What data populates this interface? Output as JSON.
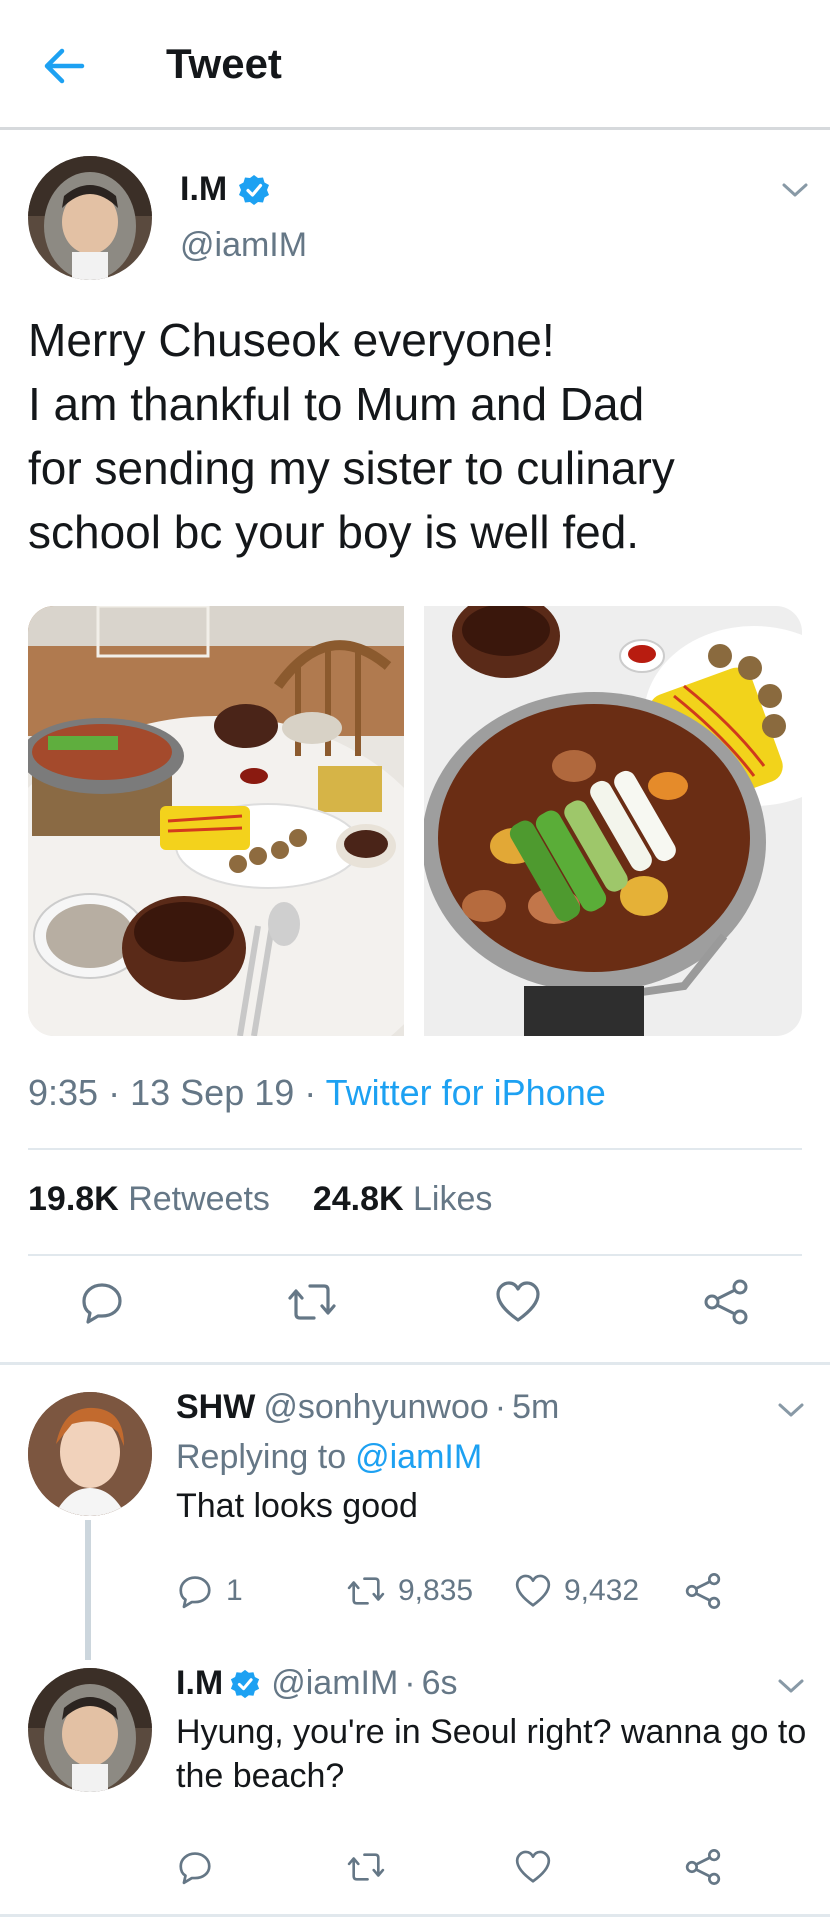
{
  "header": {
    "title": "Tweet"
  },
  "tweet": {
    "display_name": "I.M",
    "handle": "@iamIM",
    "text_lines": [
      "Merry Chuseok everyone!",
      "I am thankful to Mum and Dad",
      "for sending my sister to culinary",
      "school bc your boy is well fed."
    ],
    "time": "9:35",
    "sep": "·",
    "date": "13 Sep 19",
    "source": "Twitter for iPhone",
    "retweets_count": "19.8K",
    "retweets_label": "Retweets",
    "likes_count": "24.8K",
    "likes_label": "Likes"
  },
  "replies": [
    {
      "display_name": "SHW",
      "handle": "@sonhyunwoo",
      "sep": "·",
      "time": "5m",
      "replying_prefix": "Replying to",
      "replying_to": "@iamIM",
      "text": "That looks good",
      "reply_count": "1",
      "retweet_count": "9,835",
      "like_count": "9,432"
    },
    {
      "display_name": "I.M",
      "handle": "@iamIM",
      "sep": "·",
      "time": "6s",
      "text_lines": [
        "Hyung, you're in Seoul right? wanna go to",
        "the beach?"
      ]
    }
  ],
  "colors": {
    "accent": "#1da1f2",
    "secondary_text": "#657786",
    "divider": "#e1e8ed",
    "icon": "#657786"
  },
  "icons": [
    "back-arrow-icon",
    "verified-badge-icon",
    "chevron-down-icon",
    "reply-icon",
    "retweet-icon",
    "like-icon",
    "share-icon"
  ]
}
